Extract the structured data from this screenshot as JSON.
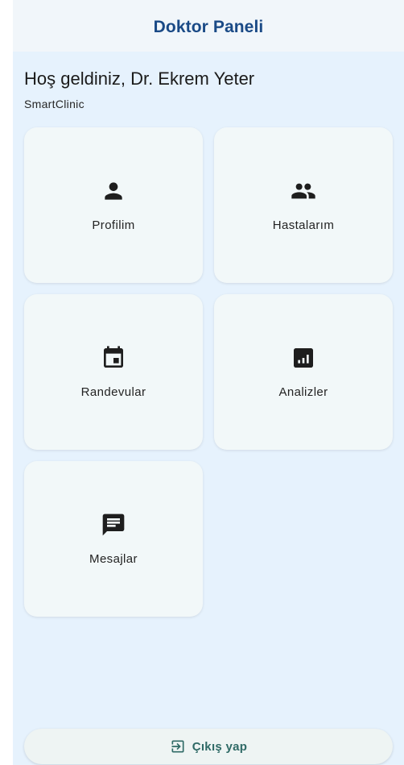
{
  "appbar": {
    "title": "Doktor Paneli"
  },
  "header": {
    "welcome": "Hoş geldiniz, Dr. Ekrem Yeter",
    "clinic": "SmartClinic"
  },
  "menu": [
    {
      "label": "Profilim",
      "icon": "person-icon"
    },
    {
      "label": "Hastalarım",
      "icon": "people-icon"
    },
    {
      "label": "Randevular",
      "icon": "calendar-icon"
    },
    {
      "label": "Analizler",
      "icon": "analytics-icon"
    },
    {
      "label": "Mesajlar",
      "icon": "message-icon"
    }
  ],
  "logout": {
    "label": "Çıkış yap",
    "icon": "logout-icon"
  },
  "colors": {
    "background": "#e6f2fd",
    "appbar": "#f1f6fa",
    "title": "#1a4a86",
    "card": "#f2f8f9",
    "logout_text": "#2f6a66"
  }
}
